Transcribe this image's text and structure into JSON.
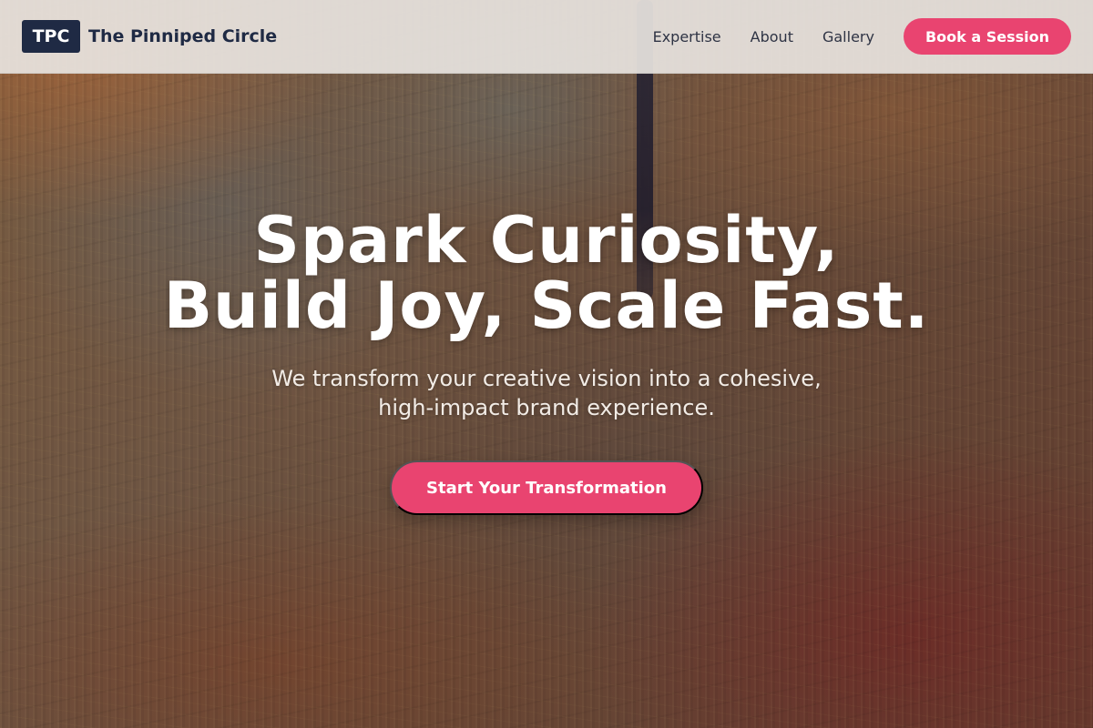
{
  "header": {
    "logo_text": "TPC",
    "brand_name": "The Pinniped Circle",
    "nav": [
      "Expertise",
      "About",
      "Gallery"
    ],
    "cta_label": "Book a Session"
  },
  "hero": {
    "title_line1": "Spark Curiosity,",
    "title_line2": "Build Joy, Scale Fast.",
    "subtitle_line1": "We transform your creative vision into a cohesive,",
    "subtitle_line2": "high-impact brand experience.",
    "cta_label": "Start Your Transformation"
  },
  "colors": {
    "accent": "#e94470",
    "brand_dark": "#1f2a44"
  }
}
